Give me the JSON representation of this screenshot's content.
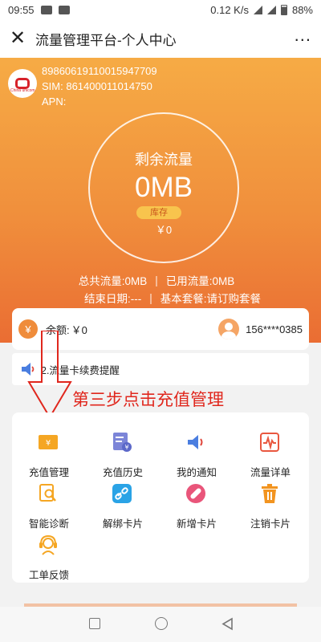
{
  "status_bar": {
    "time": "09:55",
    "speed": "0.12 K/s",
    "network": "4G",
    "battery": "88%"
  },
  "titlebar": {
    "close_icon": "close-icon",
    "title": "流量管理平台-个人中心",
    "more_icon": "more-icon"
  },
  "card_info": {
    "iccid": "89860619110015947709",
    "sim": "SIM: 861400011014750",
    "apn": "APN:"
  },
  "circle": {
    "label": "剩余流量",
    "value": "0MB",
    "badge": "库存",
    "amount": "￥0"
  },
  "stats": {
    "total": "总共流量:0MB",
    "used": "已用流量:0MB",
    "end_date": "结束日期:---",
    "package": "基本套餐:请订购套餐"
  },
  "balance": {
    "label": "余额:",
    "amount": "￥0",
    "phone": "156****0385"
  },
  "notice": {
    "text": "2.流量卡续费提醒"
  },
  "annotation": {
    "text": "第三步点击充值管理",
    "color": "#e0271d"
  },
  "menu": {
    "items": [
      {
        "label": "充值管理",
        "icon": "recharge-icon"
      },
      {
        "label": "充值历史",
        "icon": "recharge-history-icon"
      },
      {
        "label": "我的通知",
        "icon": "notification-icon"
      },
      {
        "label": "流量详单",
        "icon": "usage-detail-icon"
      },
      {
        "label": "智能诊断",
        "icon": "diagnosis-icon"
      },
      {
        "label": "解绑卡片",
        "icon": "unbind-icon"
      },
      {
        "label": "新增卡片",
        "icon": "add-card-icon"
      },
      {
        "label": "注销卡片",
        "icon": "delete-card-icon"
      },
      {
        "label": "工单反馈",
        "icon": "support-icon"
      }
    ]
  },
  "colors": {
    "accent": "#ef8c3b",
    "header_top": "#f6ab45",
    "header_bottom": "#ea6d33"
  }
}
